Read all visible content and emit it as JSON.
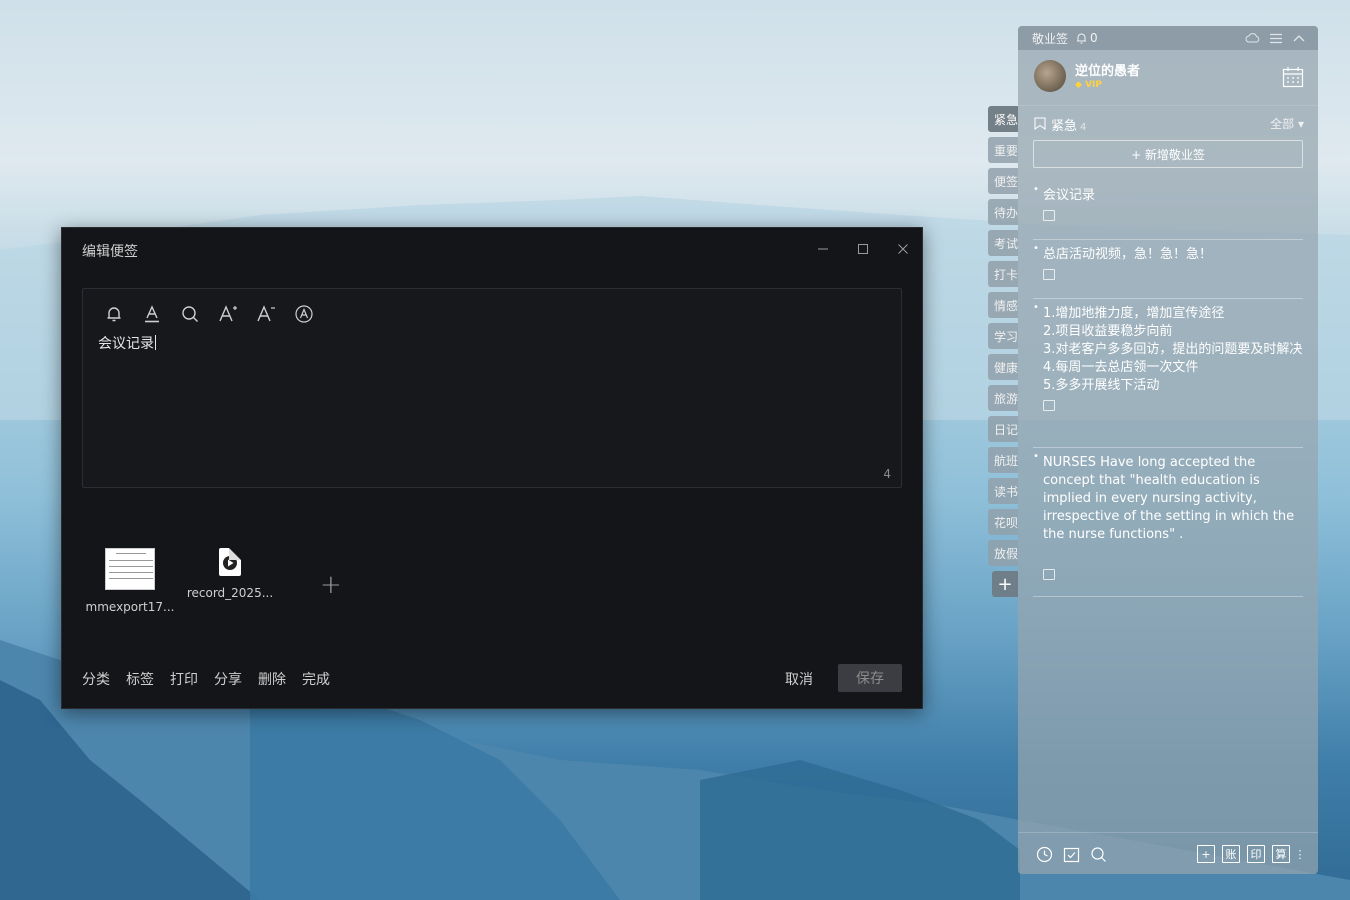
{
  "editor": {
    "title": "编辑便签",
    "content": "会议记录",
    "char_count": "4",
    "attachments": [
      {
        "name": "mmexport17..."
      },
      {
        "name": "record_2025..."
      }
    ],
    "footer_actions": [
      "分类",
      "标签",
      "打印",
      "分享",
      "删除",
      "完成"
    ],
    "cancel_label": "取消",
    "save_label": "保存"
  },
  "side_tabs": [
    "紧急",
    "重要",
    "便签",
    "待办",
    "考试",
    "打卡",
    "情感",
    "学习",
    "健康",
    "旅游",
    "日记",
    "航班",
    "读书",
    "花呗",
    "放假"
  ],
  "panel": {
    "app_name": "敬业签",
    "reminder_count": "0",
    "username": "逆位的愚者",
    "vip_label": "VIP",
    "category": "紧急",
    "category_count": "4",
    "filter_label": "全部",
    "new_button_label": "+ 新增敬业签",
    "notes": [
      {
        "text": "会议记录"
      },
      {
        "text": "总店活动视频，急！急！急！"
      },
      {
        "text": "1.增加地推力度，增加宣传途径\n2.项目收益要稳步向前\n3.对老客户多多回访，提出的问题要及时解决\n4.每周一去总店领一次文件\n5.多多开展线下活动"
      },
      {
        "text": "NURSES Have long accepted the concept that \"health education is implied in every nursing activity, irrespective of the setting in which the the nurse functions\" ."
      }
    ],
    "bottom_right_icons": [
      "账",
      "印",
      "算"
    ]
  },
  "colors": {
    "editor_bg": "#141518",
    "panel_bg": "#96a5af",
    "vip": "#ffd23f"
  }
}
